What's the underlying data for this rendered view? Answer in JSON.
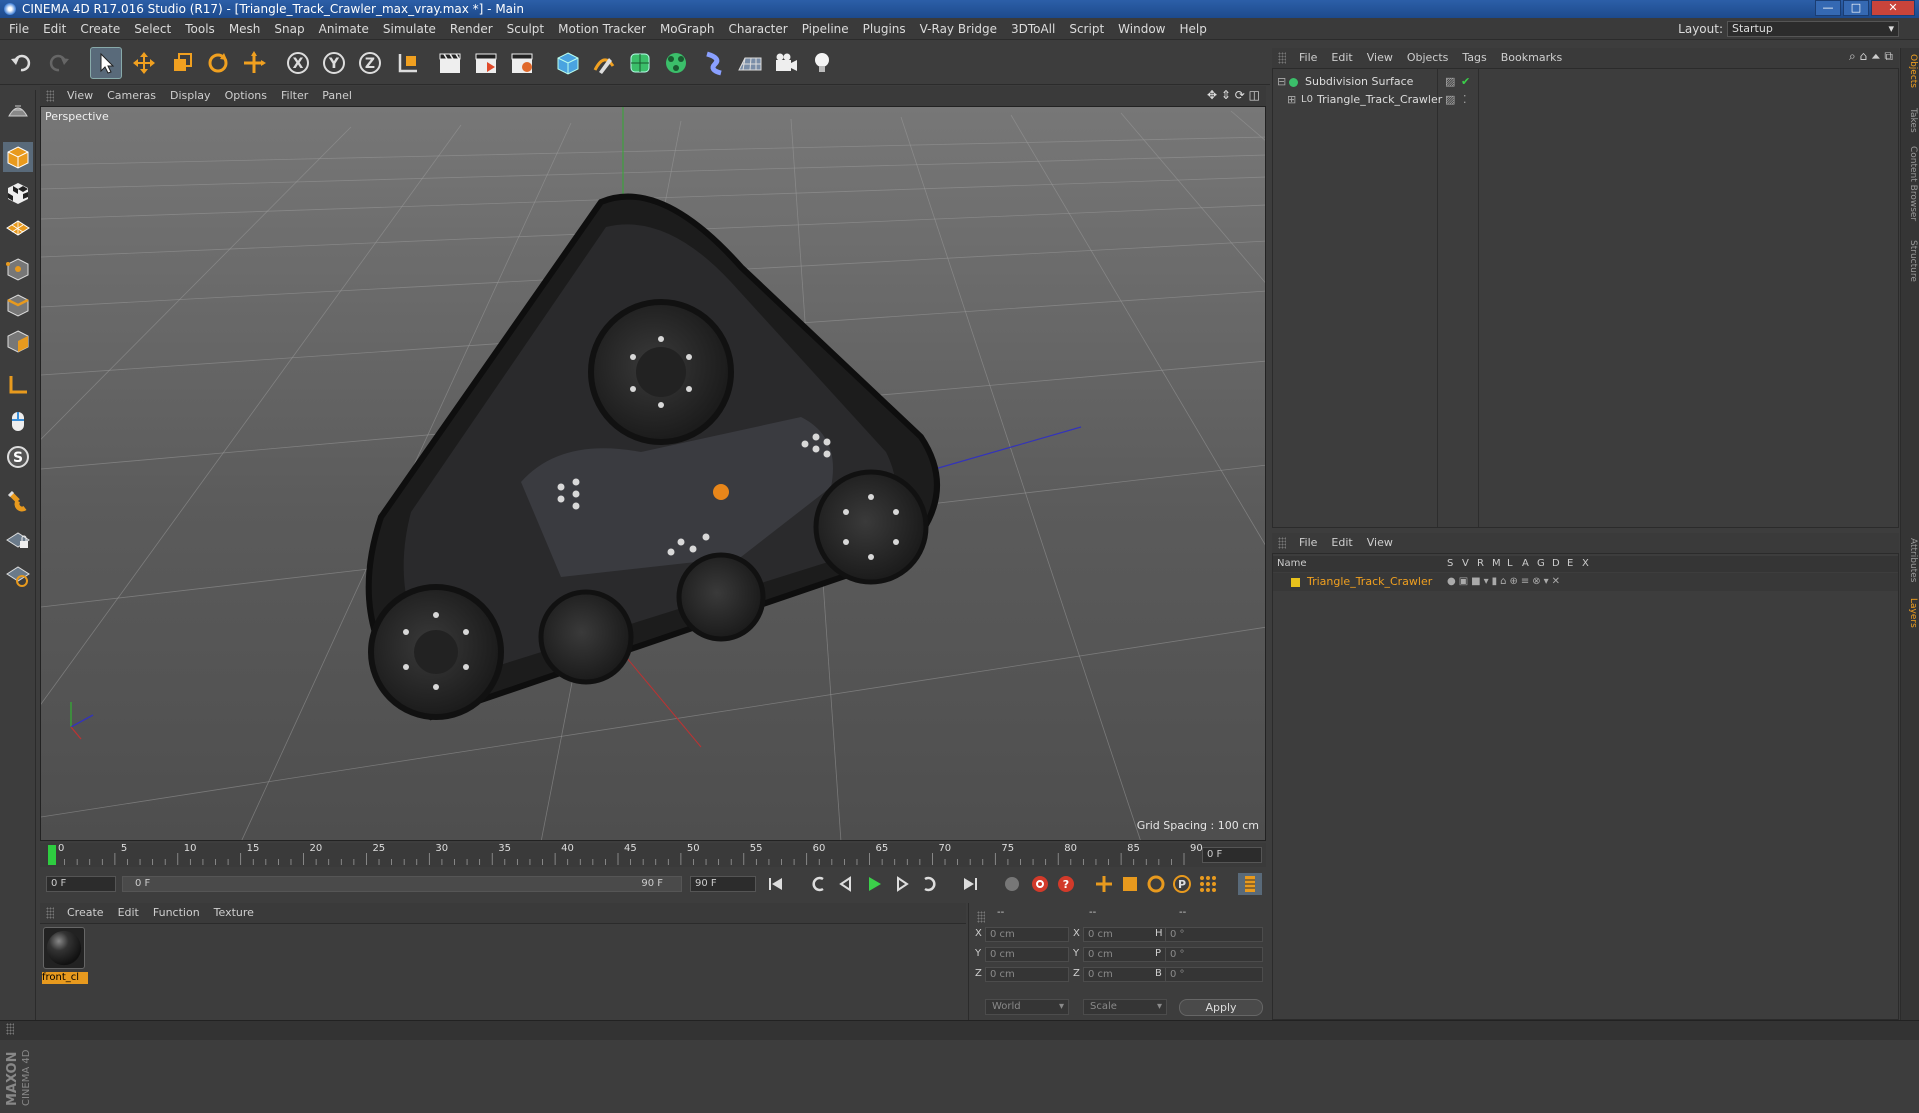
{
  "window": {
    "title": "CINEMA 4D R17.016 Studio (R17) - [Triangle_Track_Crawler_max_vray.max *] - Main",
    "buttons": {
      "minimize": "—",
      "maximize": "□",
      "close": "✕"
    }
  },
  "menubar": {
    "items": [
      "File",
      "Edit",
      "Create",
      "Select",
      "Tools",
      "Mesh",
      "Snap",
      "Animate",
      "Simulate",
      "Render",
      "Sculpt",
      "Motion Tracker",
      "MoGraph",
      "Character",
      "Pipeline",
      "Plugins",
      "V-Ray Bridge",
      "3DToAll",
      "Script",
      "Window",
      "Help"
    ],
    "layout_label": "Layout:",
    "layout_value": "Startup"
  },
  "toolbar": {
    "icons": [
      "undo-icon",
      "redo-icon",
      "select-icon",
      "move-icon",
      "scale-icon",
      "rotate-icon",
      "live-select-icon",
      "x-axis-icon",
      "y-axis-icon",
      "z-axis-icon",
      "world-coord-icon",
      "render-view-icon",
      "render-picture-viewer-icon",
      "render-settings-icon",
      "cube-icon",
      "pen-icon",
      "subdivision-icon",
      "cloner-icon",
      "deformer-icon",
      "floor-icon",
      "camera-icon",
      "light-icon"
    ]
  },
  "viewport": {
    "menu": [
      "View",
      "Cameras",
      "Display",
      "Options",
      "Filter",
      "Panel"
    ],
    "label": "Perspective",
    "grid_spacing": "Grid Spacing : 100 cm"
  },
  "timeline": {
    "ticks": [
      "0",
      "5",
      "10",
      "15",
      "20",
      "25",
      "30",
      "35",
      "40",
      "45",
      "50",
      "55",
      "60",
      "65",
      "70",
      "75",
      "80",
      "85",
      "90"
    ],
    "current_frame_field": "0 F",
    "start_field": "0 F",
    "range_start": "0 F",
    "range_end": "90 F",
    "end_field": "90 F"
  },
  "materials": {
    "menu": [
      "Create",
      "Edit",
      "Function",
      "Texture"
    ],
    "items": [
      {
        "label": "front_cl"
      }
    ]
  },
  "coordinates": {
    "headers": [
      "--",
      "--",
      "--"
    ],
    "rows": [
      {
        "l1": "X",
        "v1": "0 cm",
        "l2": "X",
        "v2": "0 cm",
        "l3": "H",
        "v3": "0 °"
      },
      {
        "l1": "Y",
        "v1": "0 cm",
        "l2": "Y",
        "v2": "0 cm",
        "l3": "P",
        "v3": "0 °"
      },
      {
        "l1": "Z",
        "v1": "0 cm",
        "l2": "Z",
        "v2": "0 cm",
        "l3": "B",
        "v3": "0 °"
      }
    ],
    "mode1": "World",
    "mode2": "Scale",
    "apply": "Apply"
  },
  "objects": {
    "menu": [
      "File",
      "Edit",
      "View",
      "Objects",
      "Tags",
      "Bookmarks"
    ],
    "items": [
      {
        "name": "Subdivision Surface"
      },
      {
        "name": "Triangle_Track_Crawler"
      }
    ]
  },
  "layers": {
    "menu": [
      "File",
      "Edit",
      "View"
    ],
    "columns": [
      "Name",
      "S",
      "V",
      "R",
      "M",
      "L",
      "A",
      "G",
      "D",
      "E",
      "X"
    ],
    "items": [
      {
        "name": "Triangle_Track_Crawler",
        "color": "#e8c21c"
      }
    ]
  },
  "right_tabs": [
    "Objects",
    "Takes",
    "Content Browser",
    "Structure",
    "Attributes",
    "Layers"
  ],
  "colors": {
    "accent": "#e89a1e",
    "selection_text": "#f0a020"
  }
}
